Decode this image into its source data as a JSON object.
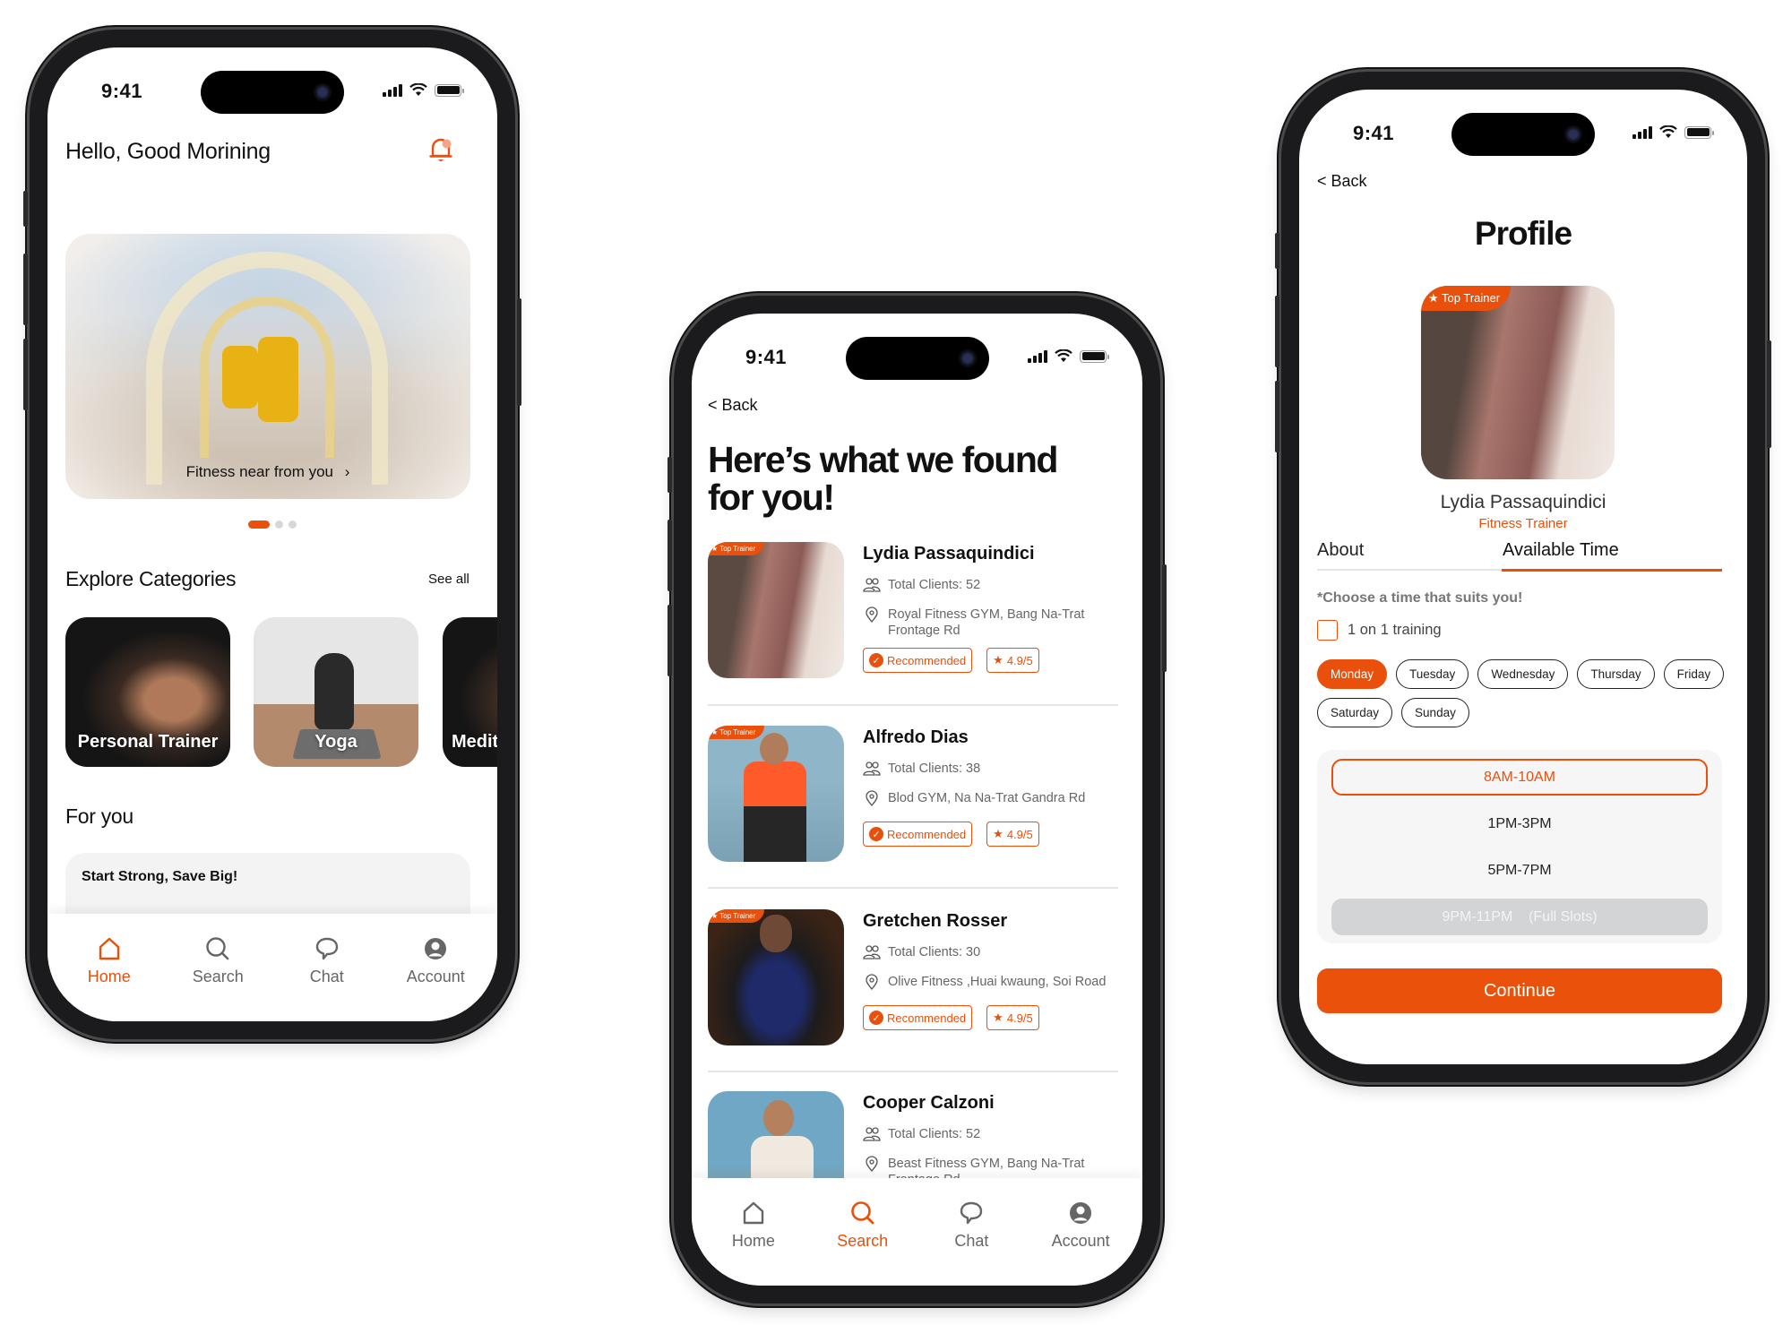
{
  "status_bar": {
    "time": "9:41"
  },
  "colors": {
    "accent": "#E8500C",
    "text": "#111111",
    "muted": "#666666",
    "full_slot": "#D3D4D6"
  },
  "home": {
    "greeting": "Hello, Good Morining",
    "notification_icon": "bell-icon",
    "banner": {
      "caption": "Fitness near from you",
      "icon": "chevron-right-icon",
      "page_count": 3,
      "active_page": 1
    },
    "categories": {
      "title": "Explore Categories",
      "see_all": "See all",
      "items": [
        {
          "label": "Personal Trainer"
        },
        {
          "label": "Yoga"
        },
        {
          "label": "Medit"
        }
      ]
    },
    "for_you": {
      "title": "For you",
      "promo": "Start Strong, Save Big!"
    }
  },
  "tabbar": {
    "items": [
      {
        "label": "Home",
        "icon": "home-icon"
      },
      {
        "label": "Search",
        "icon": "search-icon"
      },
      {
        "label": "Chat",
        "icon": "chat-icon"
      },
      {
        "label": "Account",
        "icon": "account-icon"
      }
    ]
  },
  "search_results": {
    "back": "< Back",
    "title": "Here’s what we found for you!",
    "top_badge": "Top Trainer",
    "trainers": [
      {
        "name": "Lydia Passaquindici",
        "clients": "Total Clients: 52",
        "location": "Royal Fitness GYM, Bang Na-Trat Frontage Rd",
        "recommended": "Recommended",
        "rating": "4.9/5",
        "top": true
      },
      {
        "name": "Alfredo Dias",
        "clients": "Total Clients: 38",
        "location": "Blod GYM, Na Na-Trat Gandra Rd",
        "recommended": "Recommended",
        "rating": "4.9/5",
        "top": true
      },
      {
        "name": "Gretchen Rosser",
        "clients": "Total Clients: 30",
        "location": "Olive Fitness ,Huai kwaung, Soi Road",
        "recommended": "Recommended",
        "rating": "4.9/5",
        "top": true
      },
      {
        "name": "Cooper Calzoni",
        "clients": "Total Clients: 52",
        "location": "Beast Fitness GYM, Bang Na-Trat Frontage Rd",
        "top": false
      }
    ]
  },
  "profile": {
    "back": "< Back",
    "title": "Profile",
    "badge": "Top Trainer",
    "name": "Lydia Passaquindici",
    "role": "Fitness Trainer",
    "tabs": [
      {
        "label": "About",
        "active": false
      },
      {
        "label": "Available Time",
        "active": true
      }
    ],
    "hint": "*Choose a time that suits you!",
    "checkbox_label": "1 on 1 training",
    "checkbox_checked": false,
    "days": [
      {
        "label": "Monday",
        "selected": true
      },
      {
        "label": "Tuesday",
        "selected": false
      },
      {
        "label": "Wednesday",
        "selected": false
      },
      {
        "label": "Thursday",
        "selected": false
      },
      {
        "label": "Friday",
        "selected": false
      },
      {
        "label": "Saturday",
        "selected": false
      },
      {
        "label": "Sunday",
        "selected": false
      }
    ],
    "slots": [
      {
        "label": "8AM-10AM",
        "state": "selected"
      },
      {
        "label": "1PM-3PM",
        "state": "available"
      },
      {
        "label": "5PM-7PM",
        "state": "available"
      },
      {
        "label": "9PM-11PM    (Full Slots)",
        "state": "full"
      }
    ],
    "continue": "Continue"
  }
}
